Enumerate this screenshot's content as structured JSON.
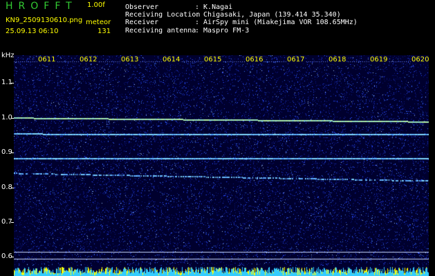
{
  "header": {
    "app_title": "HROFFT",
    "version": "1.00f",
    "filename": "KN9_2509130610.png",
    "meteor_label": "meteor",
    "datetime": "25.09.13 06:10",
    "meteor_count": "131"
  },
  "info": {
    "observer": {
      "key": "Observer",
      "value": ": K.Nagai"
    },
    "location": {
      "key": "Receiving Location",
      "value": ": Chigasaki, Japan (139.414 35.340)"
    },
    "receiver": {
      "key": "Receiver",
      "value": ": AirSpy mini (Miakejima VOR 108.65MHz)"
    },
    "antenna": {
      "key": "Receiving antenna",
      "value": ": Maspro FM-3"
    }
  },
  "spectrogram": {
    "y_unit": "kHz",
    "y_ticks": [
      "1.1",
      "1.0",
      "0.9",
      "0.8",
      "0.7",
      "0.6"
    ],
    "y_values": [
      1.1,
      1.0,
      0.9,
      0.8,
      0.7,
      0.6
    ],
    "y_range": [
      0.575,
      1.18
    ],
    "time_labels": [
      "0611",
      "0612",
      "0613",
      "0614",
      "0615",
      "0616",
      "0617",
      "0618",
      "0619",
      "0620"
    ],
    "background_color": "#00002e",
    "noise_color": "#2a4cff",
    "signal_color": "#7fd8ff",
    "carrier_color": "#b6f0a0",
    "intensity_colors": [
      "#ffff00",
      "#33ccff"
    ],
    "signal_lines": [
      {
        "start_khz": 1.001,
        "end_khz": 0.99,
        "strength": "strong"
      },
      {
        "start_khz": 0.955,
        "end_khz": 0.953,
        "strength": "medium"
      },
      {
        "start_khz": 0.884,
        "end_khz": 0.884,
        "strength": "medium"
      },
      {
        "start_khz": 0.842,
        "end_khz": 0.82,
        "strength": "weak"
      }
    ],
    "reference_lines_khz": [
      0.615,
      0.595
    ]
  }
}
